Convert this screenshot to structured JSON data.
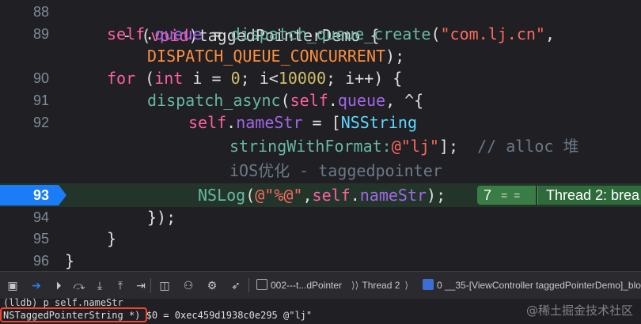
{
  "editor": {
    "lines": [
      {
        "num": "88",
        "tokens": [
          {
            "t": "- (",
            "c": "pl"
          },
          {
            "t": "void",
            "c": "kw"
          },
          {
            "t": ")",
            "c": "pl"
          },
          {
            "t": "taggedPointerDemo",
            "c": "pl"
          },
          {
            "t": " {",
            "c": "pl"
          }
        ]
      },
      {
        "num": "89",
        "tokens": [
          {
            "t": "self",
            "c": "kw"
          },
          {
            "t": ".",
            "c": "pl"
          },
          {
            "t": "queue",
            "c": "pr"
          },
          {
            "t": " = ",
            "c": "pl"
          },
          {
            "t": "dispatch_queue_create",
            "c": "fn"
          },
          {
            "t": "(",
            "c": "pl"
          },
          {
            "t": "\"com.lj.cn\"",
            "c": "str"
          },
          {
            "t": ",",
            "c": "pl"
          }
        ]
      },
      {
        "num": "",
        "tokens": [
          {
            "t": "DISPATCH_QUEUE_CONCURRENT",
            "c": "mac"
          },
          {
            "t": ");",
            "c": "pl"
          }
        ]
      },
      {
        "num": "90",
        "tokens": [
          {
            "t": "for",
            "c": "kw"
          },
          {
            "t": " (",
            "c": "pl"
          },
          {
            "t": "int",
            "c": "kw"
          },
          {
            "t": " i = ",
            "c": "pl"
          },
          {
            "t": "0",
            "c": "num"
          },
          {
            "t": "; i<",
            "c": "pl"
          },
          {
            "t": "10000",
            "c": "num"
          },
          {
            "t": "; i++) {",
            "c": "pl"
          }
        ]
      },
      {
        "num": "91",
        "tokens": [
          {
            "t": "dispatch_async",
            "c": "fn"
          },
          {
            "t": "(",
            "c": "pl"
          },
          {
            "t": "self",
            "c": "kw"
          },
          {
            "t": ".",
            "c": "pl"
          },
          {
            "t": "queue",
            "c": "pr"
          },
          {
            "t": ", ^{",
            "c": "pl"
          }
        ]
      },
      {
        "num": "92",
        "tokens": [
          {
            "t": "self",
            "c": "kw"
          },
          {
            "t": ".",
            "c": "pl"
          },
          {
            "t": "nameStr",
            "c": "pr"
          },
          {
            "t": " = [",
            "c": "pl"
          },
          {
            "t": "NSString",
            "c": "cls"
          }
        ]
      },
      {
        "num": "",
        "tokens": [
          {
            "t": "stringWithFormat:",
            "c": "fn"
          },
          {
            "t": "@\"lj\"",
            "c": "str"
          },
          {
            "t": "];  ",
            "c": "pl"
          },
          {
            "t": "// alloc 堆",
            "c": "cmt"
          }
        ]
      },
      {
        "num": "",
        "tokens": [
          {
            "t": "iOS优化 - taggedpointer",
            "c": "cmt"
          }
        ]
      },
      {
        "num": "93",
        "tokens": [
          {
            "t": "NSLog",
            "c": "fn"
          },
          {
            "t": "(",
            "c": "pl"
          },
          {
            "t": "@\"%@\"",
            "c": "str"
          },
          {
            "t": ",",
            "c": "pl"
          },
          {
            "t": "self",
            "c": "kw"
          },
          {
            "t": ".",
            "c": "pl"
          },
          {
            "t": "nameStr",
            "c": "pr"
          },
          {
            "t": ");",
            "c": "pl"
          }
        ]
      },
      {
        "num": "94",
        "tokens": [
          {
            "t": "});",
            "c": "pl"
          }
        ]
      },
      {
        "num": "95",
        "tokens": [
          {
            "t": "}",
            "c": "pl"
          }
        ]
      },
      {
        "num": "96",
        "tokens": [
          {
            "t": "}",
            "c": "pl"
          }
        ]
      }
    ],
    "breakpoint": {
      "line": "93",
      "hit_count": "7",
      "equals": "= =",
      "thread_label": "Thread 2: brea"
    }
  },
  "debug_bar": {
    "breadcrumbs": [
      {
        "label": "002---t...dPointer",
        "icon": "app-icon"
      },
      {
        "label": "Thread 2",
        "icon": "thread-icon"
      },
      {
        "label": "0 __35-[ViewController taggedPointerDemo]_bloc",
        "icon": "stack-frame-icon"
      }
    ]
  },
  "console": {
    "line1": "(lldb) p self.nameStr",
    "type_name": "NSTaggedPointerString *)",
    "value": " $0 = 0xec459d1938c0e295 @\"lj\""
  },
  "watermark": "@稀土掘金技术社区",
  "colors": {
    "background": "#1f1f24",
    "breakpoint_blue": "#1a7cf6",
    "highlight_green": "#3a7d44",
    "annotation_red": "#f0462d"
  }
}
